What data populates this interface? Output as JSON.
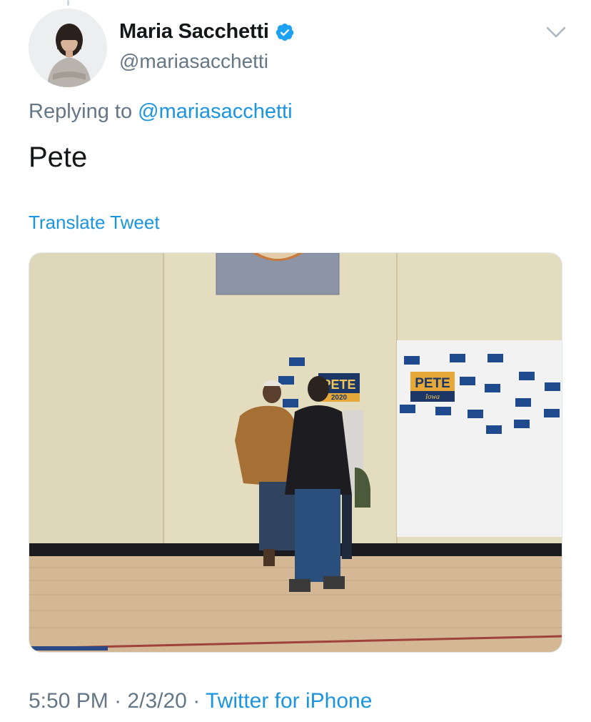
{
  "tweet": {
    "display_name": "Maria Sacchetti",
    "handle": "@mariasacchetti",
    "replying_prefix": "Replying to",
    "replying_handle": "@mariasacchetti",
    "text": "Pete",
    "translate_label": "Translate Tweet",
    "time": "5:50 PM",
    "separator": "·",
    "date": "2/3/20",
    "source": "Twitter for iPhone"
  },
  "media": {
    "sign_main": "PETE",
    "sign_main_sub": "2020",
    "sign_board": "PETE",
    "sign_board_sub": "Iowa",
    "small_sign": "PETE"
  },
  "colors": {
    "link": "#1b95e0",
    "secondary_text": "#657786",
    "verified": "#1da1f2"
  },
  "icons": [
    "verified-badge-icon",
    "chevron-down-icon"
  ]
}
